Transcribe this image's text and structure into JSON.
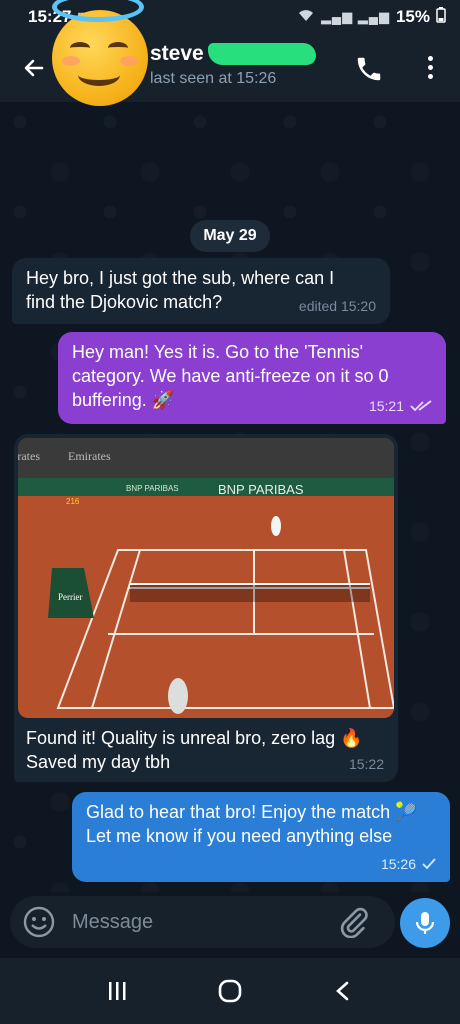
{
  "status_bar": {
    "time": "15:27",
    "battery": "15%"
  },
  "header": {
    "contact_name": "steve",
    "last_seen": "last seen at 15:26"
  },
  "chat": {
    "date": "May 29",
    "messages": [
      {
        "direction": "in",
        "text": "Hey bro, I just got the sub, where can I find the Djokovic match?",
        "meta": "edited 15:20"
      },
      {
        "direction": "out",
        "text": "Hey man! Yes it is. Go to the 'Tennis' category. We have anti-freeze on it so 0 buffering. 🚀",
        "time": "15:21",
        "status": "read"
      },
      {
        "direction": "in",
        "type": "photo",
        "photo_text": {
          "left_banner": "Emirates",
          "left_banner_cut": "irates",
          "sponsor_1": "BNP PARIBAS",
          "sponsor_2": "BNP PARIBAS",
          "court_sign": "Perrier",
          "score": "216"
        },
        "caption": "Found it! Quality is unreal bro, zero lag 🔥 Saved my day tbh",
        "time": "15:22"
      },
      {
        "direction": "out",
        "text": "Glad to hear that bro! Enjoy the match 🎾 Let me know if you need anything else",
        "time": "15:26",
        "status": "sent"
      }
    ]
  },
  "input": {
    "placeholder": "Message"
  },
  "colors": {
    "background": "#0e1621",
    "incoming_bubble": "#182533",
    "outgoing_purple": "#8a3fd1",
    "outgoing_blue": "#2b7ed6",
    "accent": "#3d9be9",
    "redaction": "#27e07d"
  },
  "icons": [
    "back-arrow-icon",
    "phone-icon",
    "more-vert-icon",
    "emoji-icon",
    "paperclip-icon",
    "microphone-icon",
    "recents-icon",
    "home-icon",
    "back-nav-icon",
    "double-check-icon",
    "check-icon"
  ]
}
